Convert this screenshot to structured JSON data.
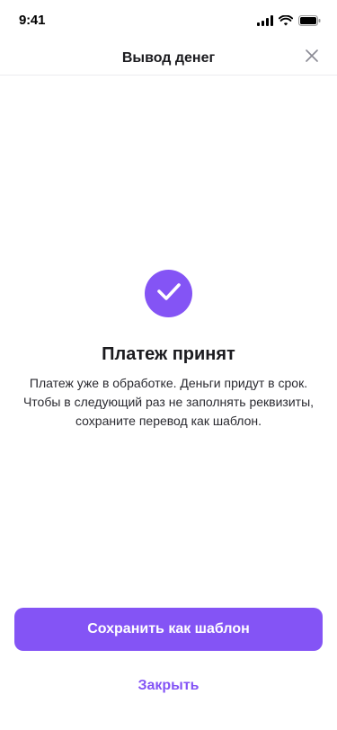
{
  "status_bar": {
    "time": "9:41",
    "icons": [
      "cellular-signal-icon",
      "wifi-icon",
      "battery-icon"
    ]
  },
  "header": {
    "title": "Вывод денег",
    "close_icon": "close-icon"
  },
  "result": {
    "icon": "checkmark-icon",
    "title": "Платеж принят",
    "description_lines": [
      "Платеж уже в обработке. Деньги придут в срок.",
      "Чтобы в следующий раз не заполнять реквизиты,",
      "сохраните перевод как шаблон."
    ]
  },
  "actions": {
    "save_template_label": "Сохранить как шаблон",
    "close_label": "Закрыть"
  },
  "colors": {
    "accent": "#8454f5",
    "text": "#1b1b1f",
    "divider": "#ececef"
  }
}
